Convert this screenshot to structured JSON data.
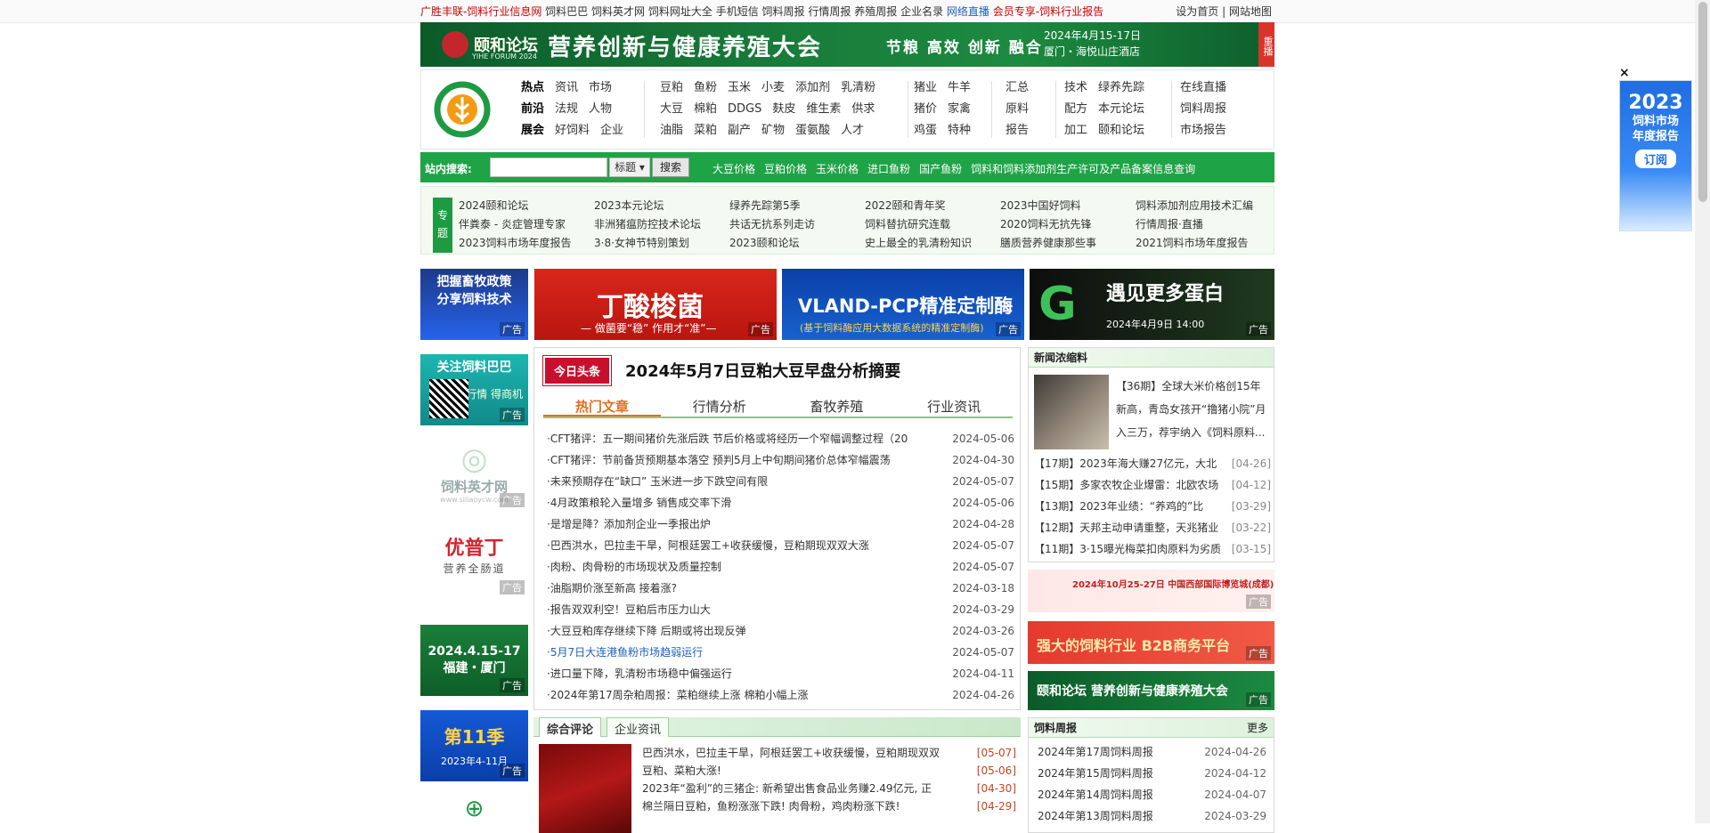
{
  "topbar": {
    "links": [
      "广胜丰联-饲料行业信息网",
      "饲料巴巴",
      "饲料英才网",
      "饲料网址大全",
      "手机短信",
      "饲料周报",
      "行情周报",
      "养殖周报",
      "企业名录",
      "网络直播",
      "会员专享-饲料行业报告"
    ],
    "right": [
      "设为首页",
      "网站地图"
    ]
  },
  "banner": {
    "logo": "颐和论坛",
    "logo_sub": "YIHE FORUM 2024",
    "title": "营养创新与健康养殖大会",
    "keywords": "节粮 高效 创新 融合",
    "date": "2024年4月15-17日",
    "place": "厦门・海悦山庄酒店",
    "tag": "重播"
  },
  "nav": {
    "group1": [
      [
        "热点",
        "资讯",
        "市场"
      ],
      [
        "前沿",
        "法规",
        "人物"
      ],
      [
        "展会",
        "好饲料",
        "企业"
      ]
    ],
    "group2": [
      [
        "豆粕",
        "鱼粉",
        "玉米",
        "小麦",
        "添加剂",
        "乳清粉"
      ],
      [
        "大豆",
        "棉粕",
        "DDGS",
        "麸皮",
        "维生素",
        "供求"
      ],
      [
        "油脂",
        "菜粕",
        "副产",
        "矿物",
        "蛋氨酸",
        "人才"
      ]
    ],
    "group3": [
      [
        "猪业",
        "牛羊"
      ],
      [
        "猪价",
        "家禽"
      ],
      [
        "鸡蛋",
        "特种"
      ]
    ],
    "group4": [
      [
        "汇总"
      ],
      [
        "原料"
      ],
      [
        "报告"
      ]
    ],
    "group5": [
      [
        "技术",
        "绿养先踪"
      ],
      [
        "配方",
        "本元论坛"
      ],
      [
        "加工",
        "颐和论坛"
      ]
    ],
    "group6": [
      [
        "在线直播"
      ],
      [
        "饲料周报"
      ],
      [
        "市场报告"
      ]
    ]
  },
  "search": {
    "label": "站内搜索:",
    "placeholder": "",
    "select": "标题",
    "button": "搜索",
    "quick_links": [
      "大豆价格",
      "豆粕价格",
      "玉米价格",
      "进口鱼粉",
      "国产鱼粉",
      "饲料和饲料添加剂生产许可及产品备案信息查询"
    ]
  },
  "topics": {
    "side": "专题",
    "items": [
      "2024颐和论坛",
      "2023本元论坛",
      "绿养先踪第5季",
      "2022颐和青年奖",
      "2023中国好饲料",
      "饲料添加剂应用技术汇编",
      "伴粪泰 - 炎症管理专家",
      "非洲猪瘟防控技术论坛",
      "共话无抗系列走访",
      "饲料替抗研究连载",
      "2020饲料无抗先锋",
      "行情周报·直播",
      "2023饲料市场年度报告",
      "3·8·女神节特别策划",
      "2023颐和论坛",
      "史上最全的乳清粉知识",
      "膳质营养健康那些事",
      "2021饲料市场年度报告"
    ]
  },
  "ads": {
    "left1": [
      "把握畜牧政策",
      "分享饲料技术"
    ],
    "left2": [
      "关注饲料巴巴",
      "知行情 得商机"
    ],
    "left3": [
      "饲料英才网",
      "www.siliaoycw.com"
    ],
    "left4": [
      "优普丁",
      "营养全肠道"
    ],
    "left5": [
      "2024.4.15-17",
      "福建・厦门"
    ],
    "left6": [
      "第11季",
      "2023年4-11月"
    ],
    "mid1": "丁酸梭菌",
    "mid1_sub": "— 做菌要“稳” 作用才“准”—",
    "mid2": "VLAND-PCP精准定制酶",
    "mid2_sub": "(基于饲料酶应用大数据系统的精准定制酶)",
    "mid3": "遇见更多蛋白",
    "mid3_sub": "2024年4月9日 14:00",
    "tag": "广告"
  },
  "headline": {
    "badge": "今日头条",
    "title": "2024年5月7日豆粕大豆早盘分析摘要"
  },
  "tabs": [
    "热门文章",
    "行情分析",
    "畜牧养殖",
    "行业资讯"
  ],
  "news": [
    {
      "t": "·CFT猪评：五一期间猪价先涨后跌 节后价格或将经历一个窄幅调整过程（20",
      "d": "2024-05-06"
    },
    {
      "t": "·CFT猪评：节前备货预期基本落空 预判5月上中旬期间猪价总体窄幅震荡",
      "d": "2024-04-30"
    },
    {
      "t": "·未来预期存在“缺口” 玉米进一步下跌空间有限",
      "d": "2024-05-07"
    },
    {
      "t": "·4月政策粮轮入量增多 销售成交率下滑",
      "d": "2024-05-06"
    },
    {
      "t": "·是增是降？添加剂企业一季报出炉",
      "d": "2024-04-28"
    },
    {
      "t": "·巴西洪水，巴拉圭干旱，阿根廷罢工+收获缓慢，豆粕期现双双大涨",
      "d": "2024-05-07"
    },
    {
      "t": "·肉粉、肉骨粉的市场现状及质量控制",
      "d": "2024-05-07"
    },
    {
      "t": "·油脂期价涨至新高 接着涨?",
      "d": "2024-03-18"
    },
    {
      "t": "·报告双双利空！豆粕后市压力山大",
      "d": "2024-03-29"
    },
    {
      "t": "·大豆豆粕库存继续下降 后期或将出现反弹",
      "d": "2024-03-26"
    },
    {
      "t": "·5月7日大连港鱼粉市场趋弱运行",
      "d": "2024-05-07"
    },
    {
      "t": "·进口量下降，乳清粉市场稳中偏强运行",
      "d": "2024-04-11"
    },
    {
      "t": "·2024年第17周杂粕周报：菜粕继续上涨 棉粕小幅上涨",
      "d": "2024-04-26"
    }
  ],
  "comment": {
    "tabs": [
      "综合评论",
      "企业资讯"
    ],
    "items": [
      {
        "t": "巴西洪水，巴拉圭干旱，阿根廷罢工+收获缓慢，豆粕期现双双",
        "d": "[05-07]"
      },
      {
        "t": "豆粕、菜粕大涨!",
        "d": "[05-06]"
      },
      {
        "t": "2023年“盈利”的三猪企: 新希望出售食品业务赚2.49亿元, 正",
        "d": "[04-30]"
      },
      {
        "t": "棉兰隔日豆粕，鱼粉涨涨下跌! 肉骨粉，鸡肉粉涨下跌!",
        "d": "[04-29]"
      }
    ]
  },
  "nongsuo": {
    "title": "新闻浓缩料",
    "lead": "【36期】全球大米价格创15年新高，青岛女孩开“撸猪小院”月入三万，荐宇纳入《饲料原料...",
    "items": [
      {
        "t": "【17期】2023年海大赚27亿元，大北",
        "d": "[04-26]"
      },
      {
        "t": "【15期】多家农牧企业爆雷：北欧农场",
        "d": "[04-12]"
      },
      {
        "t": "【13期】2023年业绩：“养鸡的”比",
        "d": "[03-29]"
      },
      {
        "t": "【12期】天邦主动申请重整，天兆猪业",
        "d": "[03-22]"
      },
      {
        "t": "【11期】3·15曝光梅菜扣肉原料为劣质",
        "d": "[03-15]"
      }
    ]
  },
  "right_ads": {
    "a1": "2024年10月25-27日 中国西部国际博览城(成都)",
    "a2": "强大的饲料行业 B2B商务平台",
    "a3": "颐和论坛 营养创新与健康养殖大会"
  },
  "weekly": {
    "title": "饲料周报",
    "more": "更多",
    "items": [
      {
        "t": "2024年第17周饲料周报",
        "d": "2024-04-26"
      },
      {
        "t": "2024年第15周饲料周报",
        "d": "2024-04-12"
      },
      {
        "t": "2024年第14周饲料周报",
        "d": "2024-04-07"
      },
      {
        "t": "2024年第13周饲料周报",
        "d": "2024-03-29"
      }
    ]
  },
  "float_ad": {
    "close": "×",
    "year": "2023",
    "line1": "饲料市场",
    "line2": "年度报告",
    "btn": "订阅"
  }
}
